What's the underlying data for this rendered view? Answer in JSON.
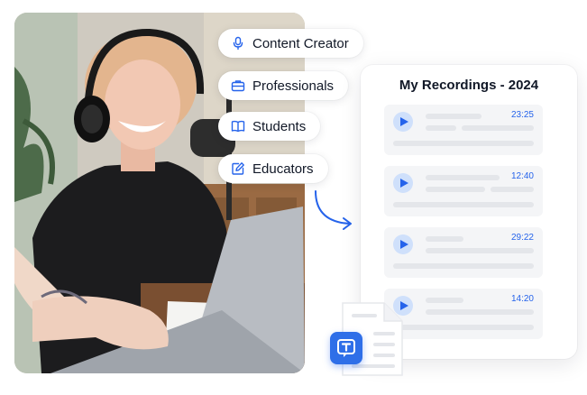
{
  "audience_pills": [
    {
      "label": "Content Creator",
      "icon": "microphone-icon"
    },
    {
      "label": "Professionals",
      "icon": "briefcase-icon"
    },
    {
      "label": "Students",
      "icon": "book-icon"
    },
    {
      "label": "Educators",
      "icon": "edit-icon"
    }
  ],
  "recordings_card": {
    "title": "My Recordings - 2024",
    "items": [
      {
        "duration": "23:25"
      },
      {
        "duration": "12:40"
      },
      {
        "duration": "29:22"
      },
      {
        "duration": "14:20"
      }
    ]
  },
  "colors": {
    "accent": "#2563eb",
    "play_bg": "#cfe0fb",
    "placeholder_bar": "#e4e6ea",
    "logo_bg": "#2f6fe8"
  },
  "icons": {
    "arrow": "curved-arrow-icon",
    "document": "document-icon",
    "logo": "transcription-logo-icon"
  }
}
